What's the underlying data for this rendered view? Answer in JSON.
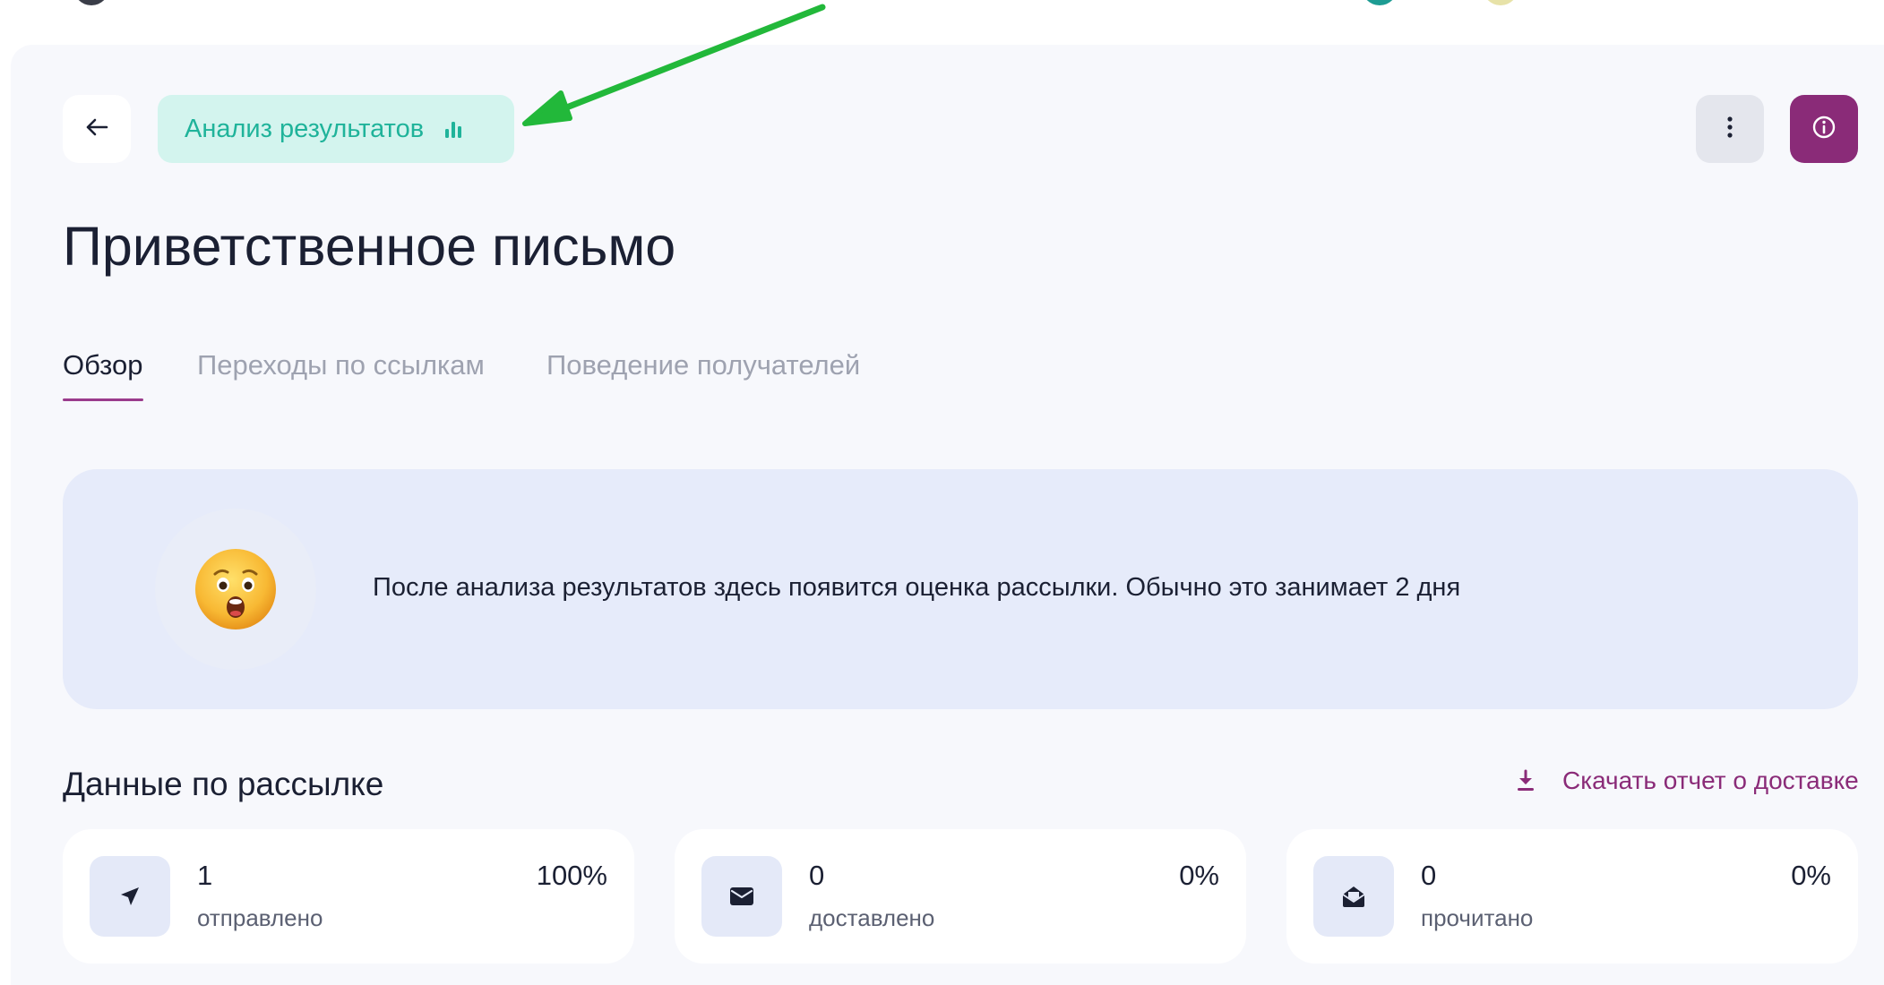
{
  "colors": {
    "accent": "#8a2b78",
    "chip_bg": "#d3f4ee",
    "chip_text": "#1fb39a",
    "annotation_arrow": "#22b83a"
  },
  "header": {
    "back_icon": "arrow-left-icon",
    "analysis_chip_label": "Анализ результатов",
    "analysis_chip_icon": "bar-chart-icon",
    "more_icon": "more-vertical-icon",
    "info_icon": "info-icon"
  },
  "page": {
    "title": "Приветственное письмо"
  },
  "tabs": [
    {
      "label": "Обзор",
      "active": true
    },
    {
      "label": "Переходы по ссылкам",
      "active": false
    },
    {
      "label": "Поведение получателей",
      "active": false
    }
  ],
  "notice": {
    "emoji": "astonished-face-emoji",
    "text": "После анализа результатов здесь появится оценка рассылки. Обычно это занимает 2 дня"
  },
  "delivery": {
    "section_title": "Данные по рассылке",
    "download_label": "Скачать отчет о доставке",
    "download_icon": "download-icon",
    "stats": [
      {
        "icon": "send-icon",
        "value": "1",
        "label": "отправлено",
        "percent": "100%"
      },
      {
        "icon": "envelope-icon",
        "value": "0",
        "label": "доставлено",
        "percent": "0%"
      },
      {
        "icon": "envelope-open-icon",
        "value": "0",
        "label": "прочитано",
        "percent": "0%"
      }
    ]
  }
}
